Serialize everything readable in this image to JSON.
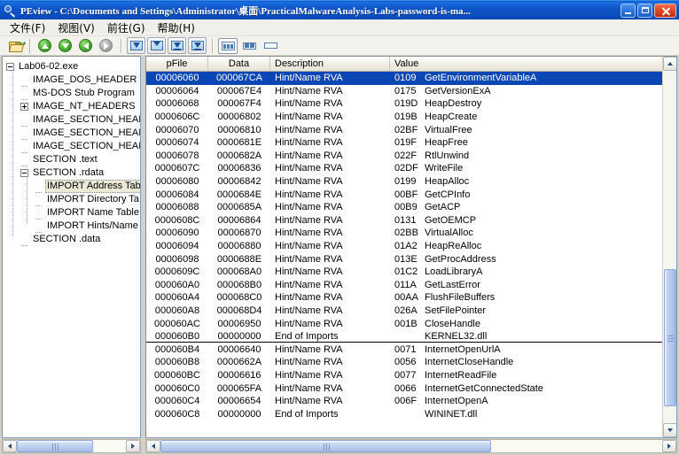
{
  "window": {
    "title": "PEview - C:\\Documents and Settings\\Administrator\\桌面\\PracticalMalwareAnalysis-Labs-password-is-ma...",
    "icon": "magnifier-icon",
    "minimize_label": "Minimize",
    "maximize_label": "Maximize",
    "close_label": "Close"
  },
  "menu": {
    "items": [
      {
        "label": "文件(F)"
      },
      {
        "label": "视图(V)"
      },
      {
        "label": "前往(G)"
      },
      {
        "label": "帮助(H)"
      }
    ]
  },
  "toolbar": {
    "buttons": [
      {
        "name": "open-file-button",
        "icon": "folder-open-icon"
      },
      {
        "name": "nav-up-button",
        "icon": "circle-arrow-up-icon"
      },
      {
        "name": "nav-down-button",
        "icon": "circle-arrow-down-icon"
      },
      {
        "name": "nav-back-button",
        "icon": "circle-arrow-left-icon"
      },
      {
        "name": "nav-forward-button",
        "icon": "circle-arrow-right-icon"
      },
      {
        "name": "goto-first-button",
        "icon": "blue-arrow-down-icon"
      },
      {
        "name": "goto-prev-button",
        "icon": "blue-arrow-down-outline-icon"
      },
      {
        "name": "goto-next-button",
        "icon": "blue-double-arrow-down-icon"
      },
      {
        "name": "goto-last-button",
        "icon": "blue-arrow-down-bar-icon"
      },
      {
        "name": "view-detail-button",
        "icon": "view-detail-icon"
      },
      {
        "name": "view-split-button",
        "icon": "view-split-icon"
      },
      {
        "name": "view-single-button",
        "icon": "view-single-icon"
      }
    ]
  },
  "tree": {
    "nodes": [
      {
        "label": "Lab06-02.exe",
        "depth": 0,
        "toggle": "minus",
        "selected": false
      },
      {
        "label": "IMAGE_DOS_HEADER",
        "depth": 1,
        "toggle": "none",
        "selected": false
      },
      {
        "label": "MS-DOS Stub Program",
        "depth": 1,
        "toggle": "none",
        "selected": false
      },
      {
        "label": "IMAGE_NT_HEADERS",
        "depth": 1,
        "toggle": "plus",
        "selected": false
      },
      {
        "label": "IMAGE_SECTION_HEAI",
        "depth": 1,
        "toggle": "none",
        "selected": false
      },
      {
        "label": "IMAGE_SECTION_HEAI",
        "depth": 1,
        "toggle": "none",
        "selected": false
      },
      {
        "label": "IMAGE_SECTION_HEAI",
        "depth": 1,
        "toggle": "none",
        "selected": false
      },
      {
        "label": "SECTION .text",
        "depth": 1,
        "toggle": "none",
        "selected": false
      },
      {
        "label": "SECTION .rdata",
        "depth": 1,
        "toggle": "minus",
        "selected": false
      },
      {
        "label": "IMPORT Address Tab",
        "depth": 2,
        "toggle": "none",
        "selected": true
      },
      {
        "label": "IMPORT Directory Ta",
        "depth": 2,
        "toggle": "none",
        "selected": false
      },
      {
        "label": "IMPORT Name Table",
        "depth": 2,
        "toggle": "none",
        "selected": false
      },
      {
        "label": "IMPORT Hints/Name",
        "depth": 2,
        "toggle": "none",
        "selected": false
      },
      {
        "label": "SECTION .data",
        "depth": 1,
        "toggle": "none",
        "selected": false
      }
    ]
  },
  "list": {
    "columns": [
      "pFile",
      "Data",
      "Description",
      "Value"
    ],
    "rows": [
      {
        "pfile": "00006060",
        "data": "000067CA",
        "desc": "Hint/Name RVA",
        "ord": "0109",
        "name": "GetEnvironmentVariableA",
        "selected": true,
        "sep_below": false
      },
      {
        "pfile": "00006064",
        "data": "000067E4",
        "desc": "Hint/Name RVA",
        "ord": "0175",
        "name": "GetVersionExA",
        "selected": false,
        "sep_below": false
      },
      {
        "pfile": "00006068",
        "data": "000067F4",
        "desc": "Hint/Name RVA",
        "ord": "019D",
        "name": "HeapDestroy",
        "selected": false,
        "sep_below": false
      },
      {
        "pfile": "0000606C",
        "data": "00006802",
        "desc": "Hint/Name RVA",
        "ord": "019B",
        "name": "HeapCreate",
        "selected": false,
        "sep_below": false
      },
      {
        "pfile": "00006070",
        "data": "00006810",
        "desc": "Hint/Name RVA",
        "ord": "02BF",
        "name": "VirtualFree",
        "selected": false,
        "sep_below": false
      },
      {
        "pfile": "00006074",
        "data": "0000681E",
        "desc": "Hint/Name RVA",
        "ord": "019F",
        "name": "HeapFree",
        "selected": false,
        "sep_below": false
      },
      {
        "pfile": "00006078",
        "data": "0000682A",
        "desc": "Hint/Name RVA",
        "ord": "022F",
        "name": "RtlUnwind",
        "selected": false,
        "sep_below": false
      },
      {
        "pfile": "0000607C",
        "data": "00006836",
        "desc": "Hint/Name RVA",
        "ord": "02DF",
        "name": "WriteFile",
        "selected": false,
        "sep_below": false
      },
      {
        "pfile": "00006080",
        "data": "00006842",
        "desc": "Hint/Name RVA",
        "ord": "0199",
        "name": "HeapAlloc",
        "selected": false,
        "sep_below": false
      },
      {
        "pfile": "00006084",
        "data": "0000684E",
        "desc": "Hint/Name RVA",
        "ord": "00BF",
        "name": "GetCPInfo",
        "selected": false,
        "sep_below": false
      },
      {
        "pfile": "00006088",
        "data": "0000685A",
        "desc": "Hint/Name RVA",
        "ord": "00B9",
        "name": "GetACP",
        "selected": false,
        "sep_below": false
      },
      {
        "pfile": "0000608C",
        "data": "00006864",
        "desc": "Hint/Name RVA",
        "ord": "0131",
        "name": "GetOEMCP",
        "selected": false,
        "sep_below": false
      },
      {
        "pfile": "00006090",
        "data": "00006870",
        "desc": "Hint/Name RVA",
        "ord": "02BB",
        "name": "VirtualAlloc",
        "selected": false,
        "sep_below": false
      },
      {
        "pfile": "00006094",
        "data": "00006880",
        "desc": "Hint/Name RVA",
        "ord": "01A2",
        "name": "HeapReAlloc",
        "selected": false,
        "sep_below": false
      },
      {
        "pfile": "00006098",
        "data": "0000688E",
        "desc": "Hint/Name RVA",
        "ord": "013E",
        "name": "GetProcAddress",
        "selected": false,
        "sep_below": false
      },
      {
        "pfile": "0000609C",
        "data": "000068A0",
        "desc": "Hint/Name RVA",
        "ord": "01C2",
        "name": "LoadLibraryA",
        "selected": false,
        "sep_below": false
      },
      {
        "pfile": "000060A0",
        "data": "000068B0",
        "desc": "Hint/Name RVA",
        "ord": "011A",
        "name": "GetLastError",
        "selected": false,
        "sep_below": false
      },
      {
        "pfile": "000060A4",
        "data": "000068C0",
        "desc": "Hint/Name RVA",
        "ord": "00AA",
        "name": "FlushFileBuffers",
        "selected": false,
        "sep_below": false
      },
      {
        "pfile": "000060A8",
        "data": "000068D4",
        "desc": "Hint/Name RVA",
        "ord": "026A",
        "name": "SetFilePointer",
        "selected": false,
        "sep_below": false
      },
      {
        "pfile": "000060AC",
        "data": "00006950",
        "desc": "Hint/Name RVA",
        "ord": "001B",
        "name": "CloseHandle",
        "selected": false,
        "sep_below": false
      },
      {
        "pfile": "000060B0",
        "data": "00000000",
        "desc": "End of Imports",
        "ord": "",
        "name": "KERNEL32.dll",
        "selected": false,
        "sep_below": true
      },
      {
        "pfile": "000060B4",
        "data": "00006640",
        "desc": "Hint/Name RVA",
        "ord": "0071",
        "name": "InternetOpenUrlA",
        "selected": false,
        "sep_below": false
      },
      {
        "pfile": "000060B8",
        "data": "0000662A",
        "desc": "Hint/Name RVA",
        "ord": "0056",
        "name": "InternetCloseHandle",
        "selected": false,
        "sep_below": false
      },
      {
        "pfile": "000060BC",
        "data": "00006616",
        "desc": "Hint/Name RVA",
        "ord": "0077",
        "name": "InternetReadFile",
        "selected": false,
        "sep_below": false
      },
      {
        "pfile": "000060C0",
        "data": "000065FA",
        "desc": "Hint/Name RVA",
        "ord": "0066",
        "name": "InternetGetConnectedState",
        "selected": false,
        "sep_below": false
      },
      {
        "pfile": "000060C4",
        "data": "00006654",
        "desc": "Hint/Name RVA",
        "ord": "006F",
        "name": "InternetOpenA",
        "selected": false,
        "sep_below": false
      },
      {
        "pfile": "000060C8",
        "data": "00000000",
        "desc": "End of Imports",
        "ord": "",
        "name": "WININET.dll",
        "selected": false,
        "sep_below": false
      }
    ]
  },
  "colors": {
    "selection": "#0a46b4",
    "title_bar": "#0b4cbd",
    "tree_selection": "#ece9d8"
  }
}
